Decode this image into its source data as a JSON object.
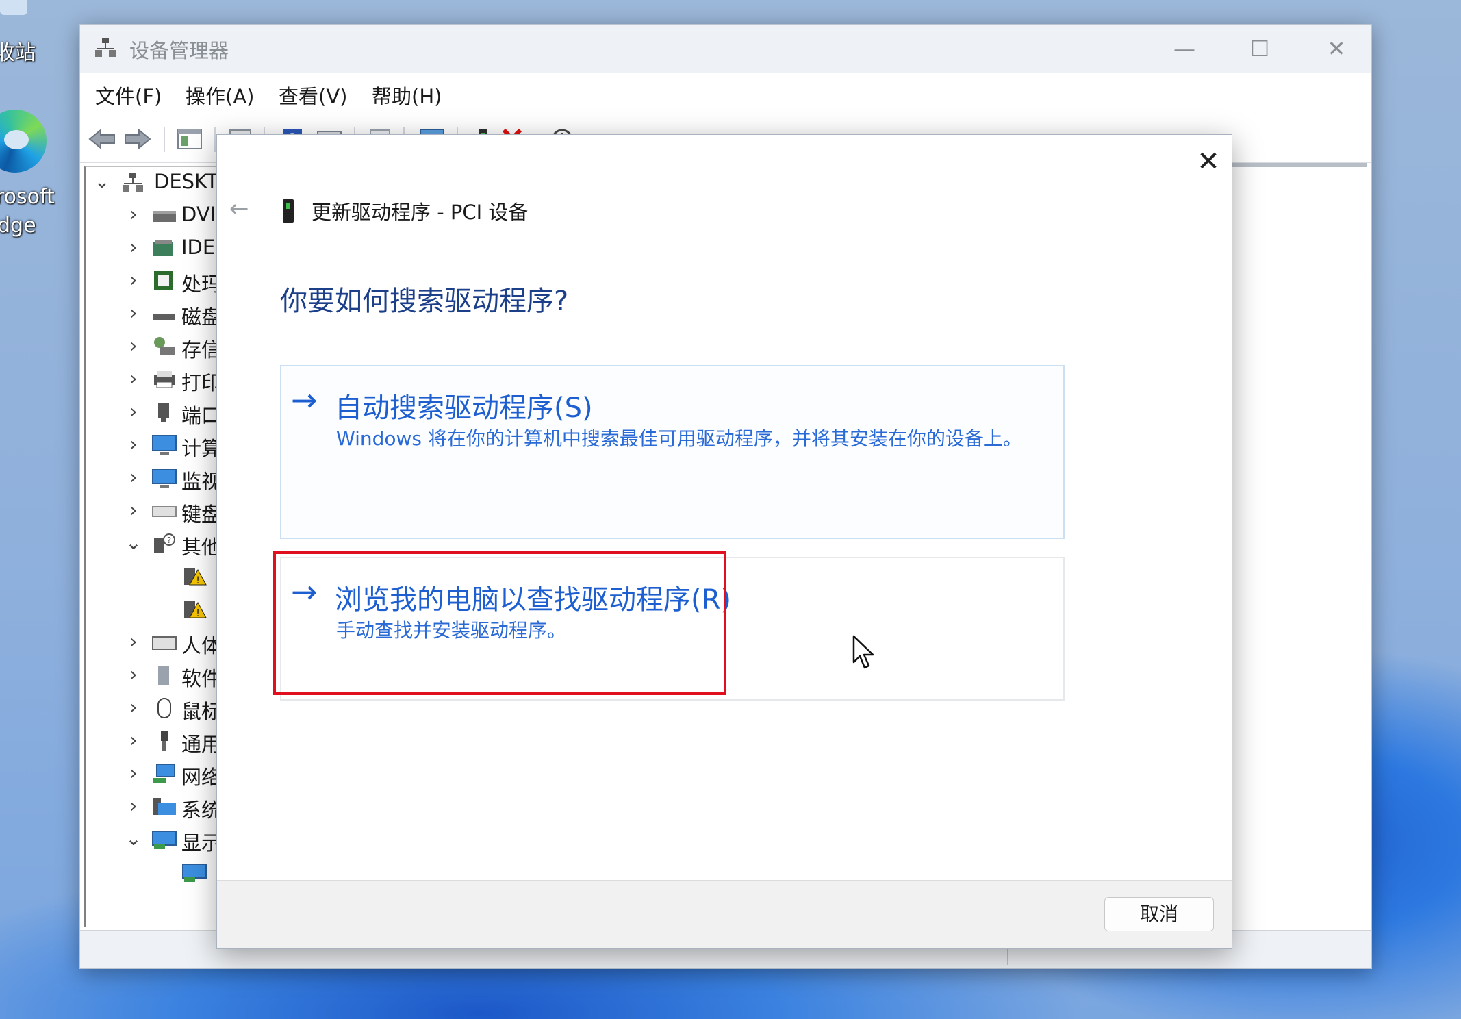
{
  "desktop": {
    "recycle_label": "收站",
    "edge_label_line1": "rosoft",
    "edge_label_line2": "dge"
  },
  "window": {
    "title": "设备管理器",
    "controls": {
      "minimize": "—",
      "maximize": "☐",
      "close": "✕"
    }
  },
  "menu": [
    "文件(F)",
    "操作(A)",
    "查看(V)",
    "帮助(H)"
  ],
  "tree": [
    {
      "label": "DESKT",
      "chev": "v",
      "level": 0
    },
    {
      "label": "DVI",
      "chev": ">",
      "level": 1
    },
    {
      "label": "IDE",
      "chev": ">",
      "level": 1
    },
    {
      "label": "处玛",
      "chev": ">",
      "level": 1
    },
    {
      "label": "磁盘",
      "chev": ">",
      "level": 1
    },
    {
      "label": "存信",
      "chev": ">",
      "level": 1
    },
    {
      "label": "打印",
      "chev": ">",
      "level": 1
    },
    {
      "label": "端口",
      "chev": ">",
      "level": 1
    },
    {
      "label": "计算",
      "chev": ">",
      "level": 1
    },
    {
      "label": "监视",
      "chev": ">",
      "level": 1
    },
    {
      "label": "键盘",
      "chev": ">",
      "level": 1
    },
    {
      "label": "其他",
      "chev": "v",
      "level": 1
    },
    {
      "label": "",
      "chev": "",
      "level": 2
    },
    {
      "label": "",
      "chev": "",
      "level": 2
    },
    {
      "label": "人体",
      "chev": ">",
      "level": 1
    },
    {
      "label": "软件",
      "chev": ">",
      "level": 1
    },
    {
      "label": "鼠标",
      "chev": ">",
      "level": 1
    },
    {
      "label": "通用",
      "chev": ">",
      "level": 1
    },
    {
      "label": "网络",
      "chev": ">",
      "level": 1
    },
    {
      "label": "系统",
      "chev": ">",
      "level": 1
    },
    {
      "label": "显示",
      "chev": "v",
      "level": 1
    },
    {
      "label": "",
      "chev": "",
      "level": 2
    }
  ],
  "dialog": {
    "close": "✕",
    "back": "←",
    "title": "更新驱动程序 - PCI 设备",
    "question": "你要如何搜索驱动程序?",
    "options": [
      {
        "arrow": "→",
        "title": "自动搜索驱动程序(S)",
        "desc": "Windows 将在你的计算机中搜索最佳可用驱动程序，并将其安装在你的设备上。"
      },
      {
        "arrow": "→",
        "title": "浏览我的电脑以查找驱动程序(R)",
        "desc": "手动查找并安装驱动程序。"
      }
    ],
    "cancel": "取消"
  },
  "colors": {
    "accent": "#1d5fd0",
    "highlight": "#e0101e",
    "question": "#1b3f88"
  }
}
